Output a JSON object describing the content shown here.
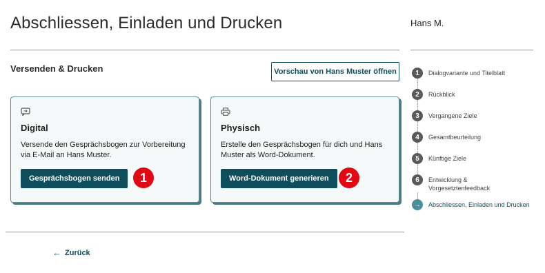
{
  "header": {
    "title": "Abschliessen, Einladen und Drucken",
    "user": "Hans M."
  },
  "section": {
    "title": "Versenden & Drucken",
    "preview_button": "Vorschau von Hans Muster öffnen"
  },
  "cards": [
    {
      "icon": "chat-icon",
      "title": "Digital",
      "text": "Versende den Gesprächsbogen zur Vorbereitung via E-Mail an Hans Muster.",
      "button": "Gesprächsbogen senden",
      "badge": "1"
    },
    {
      "icon": "printer-icon",
      "title": "Physisch",
      "text": "Erstelle den Gesprächsbogen für dich und Hans Muster als Word-Dokument.",
      "button": "Word-Dokument generieren",
      "badge": "2"
    }
  ],
  "footer": {
    "back": "Zurück"
  },
  "steps": [
    {
      "num": "1",
      "label": "Dialogvariante und Titelblatt"
    },
    {
      "num": "2",
      "label": "Rückblick"
    },
    {
      "num": "3",
      "label": "Vergangene Ziele"
    },
    {
      "num": "4",
      "label": "Gesamtbeurteilung"
    },
    {
      "num": "5",
      "label": "Künftige Ziele"
    },
    {
      "num": "6",
      "label": "Entwicklung & Vorgesetztenfeedback"
    },
    {
      "num": "→",
      "label": "Abschliessen, Einladen und Drucken",
      "active": true
    }
  ],
  "colors": {
    "accent": "#0e4d5c",
    "card_border": "#5f8a92",
    "badge": "#e30613",
    "step_active": "#4a8e9c"
  }
}
